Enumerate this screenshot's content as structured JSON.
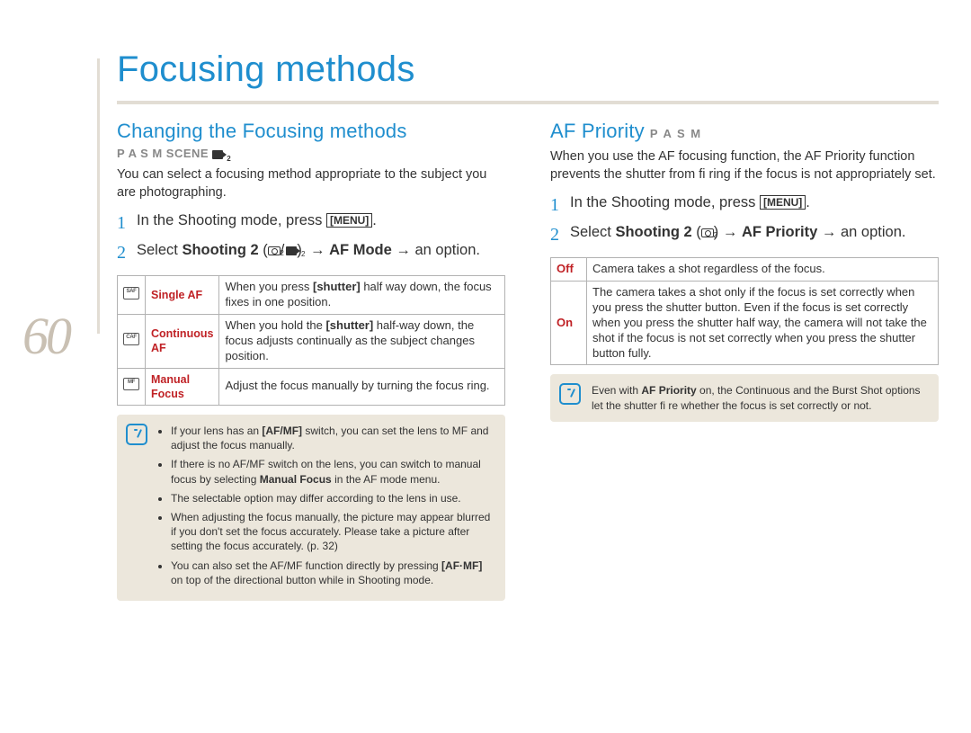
{
  "page_number": "60",
  "page_title": "Focusing methods",
  "left": {
    "heading": "Changing the Focusing methods",
    "modes": "P A S M SCENE",
    "intro": "You can select a focusing method appropriate to the subject you are photographing.",
    "steps": [
      {
        "n": "1",
        "text": "In the Shooting mode, press ",
        "kbd": "MENU",
        "tail": "."
      },
      {
        "n": "2",
        "text_html": "Select <b>Shooting 2</b> (<span class='cam-icon'></span>/<span class='mov-icon'></span>) &nbsp;→ <b>AF Mode</b> → an option."
      }
    ],
    "options": [
      {
        "icon": "SAF",
        "label": "Single AF",
        "desc_html": "When you press <b>[shutter]</b> half way down, the focus fixes in one position."
      },
      {
        "icon": "CAF",
        "label": "Continuous AF",
        "desc_html": "When you hold the <b>[shutter]</b> half-way down, the focus adjusts continually as the subject changes position."
      },
      {
        "icon": "MF",
        "label": "Manual Focus",
        "desc_html": "Adjust the focus manually by turning the focus ring."
      }
    ],
    "notes": [
      "If your lens has an <b>[AF/MF]</b> switch, you can set the lens to MF and adjust the focus manually.",
      "If there is no AF/MF switch on the lens, you can switch to manual focus by selecting <b>Manual Focus</b> in the AF mode menu.",
      "The selectable option may differ according to the lens in use.",
      "When adjusting the focus manually, the picture may appear blurred if you don't set the focus accurately. Please take a picture after setting the focus accurately. (p. 32)",
      "You can also set the AF/MF function directly by pressing <b>[AF·MF]</b> on top of the directional button while in Shooting mode."
    ]
  },
  "right": {
    "heading": "AF Priority",
    "modes": "P A S M",
    "intro": "When you use the AF focusing function, the AF Priority function prevents the shutter from fi ring if the focus is not appropriately set.",
    "steps": [
      {
        "n": "1",
        "text": "In the Shooting mode, press ",
        "kbd": "MENU",
        "tail": "."
      },
      {
        "n": "2",
        "text_html": "Select <b>Shooting 2</b> (<span class='cam-icon'></span>) → <b>AF Priority</b> → an option."
      }
    ],
    "options": [
      {
        "label": "Off",
        "desc": "Camera takes a shot regardless of the focus."
      },
      {
        "label": "On",
        "desc": "The camera takes a shot only if the focus is set correctly when you press the shutter button. Even if the focus is set correctly when you press the shutter half way, the camera will not take the shot if the focus is not set correctly when you press the shutter button fully."
      }
    ],
    "note_html": "Even with <b>AF Priority</b> on, the Continuous and the Burst Shot options let the shutter fi re whether the focus is set correctly or not."
  }
}
